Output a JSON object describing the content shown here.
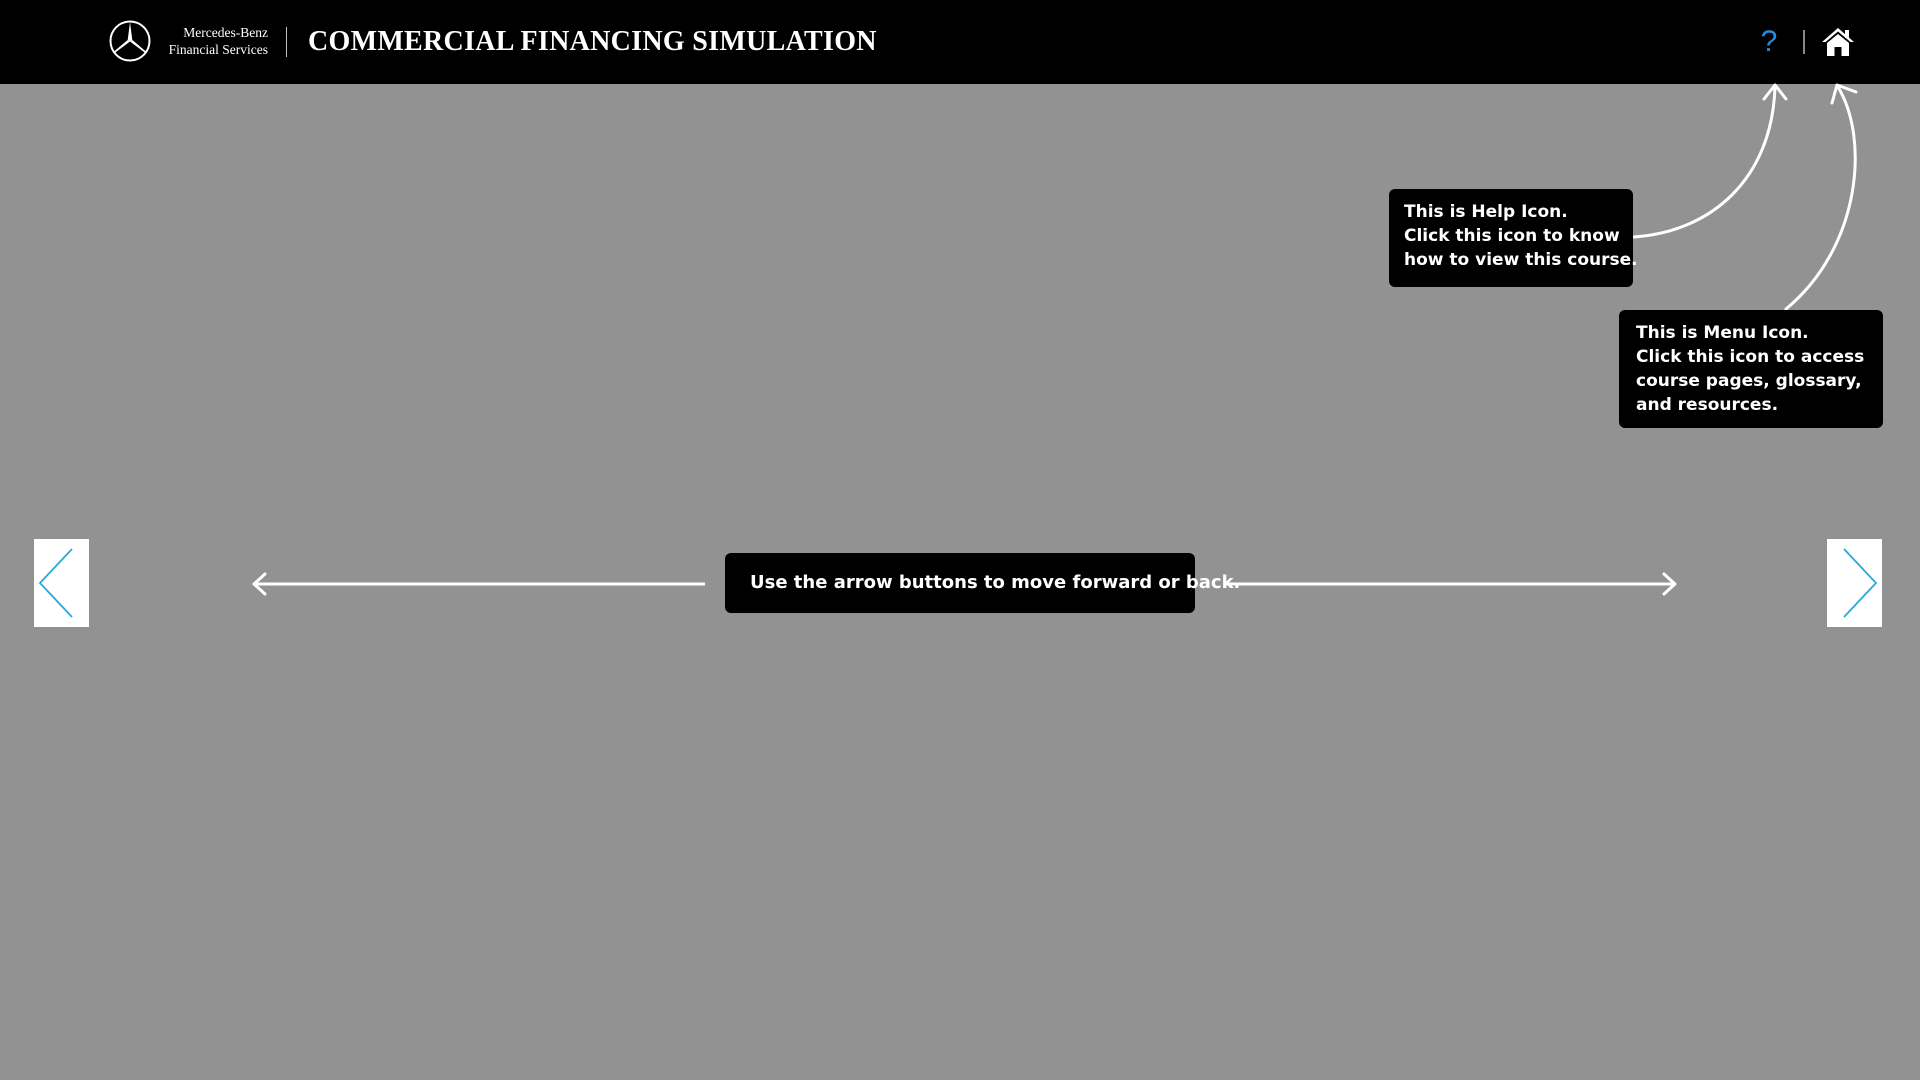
{
  "header": {
    "brand_line1": "Mercedes-Benz",
    "brand_line2": "Financial Services",
    "title": "COMMERCIAL FINANCING SIMULATION",
    "help_label": "?",
    "help_icon": "question-mark-icon",
    "home_icon": "home-icon"
  },
  "callouts": {
    "help": {
      "line1": "This is Help Icon.",
      "line2": "Click this icon to know",
      "line3": "how to view this course."
    },
    "menu": {
      "line1": "This is Menu Icon.",
      "line2": "Click this icon to access",
      "line3": "course pages, glossary,",
      "line4": "and resources."
    },
    "nav": {
      "text": "Use the arrow buttons to move forward or back."
    }
  },
  "navigation": {
    "prev_icon": "chevron-left-icon",
    "next_icon": "chevron-right-icon"
  },
  "colors": {
    "background": "#929292",
    "header": "#000000",
    "accent": "#1e90e6",
    "chevron": "#29a9d6"
  }
}
